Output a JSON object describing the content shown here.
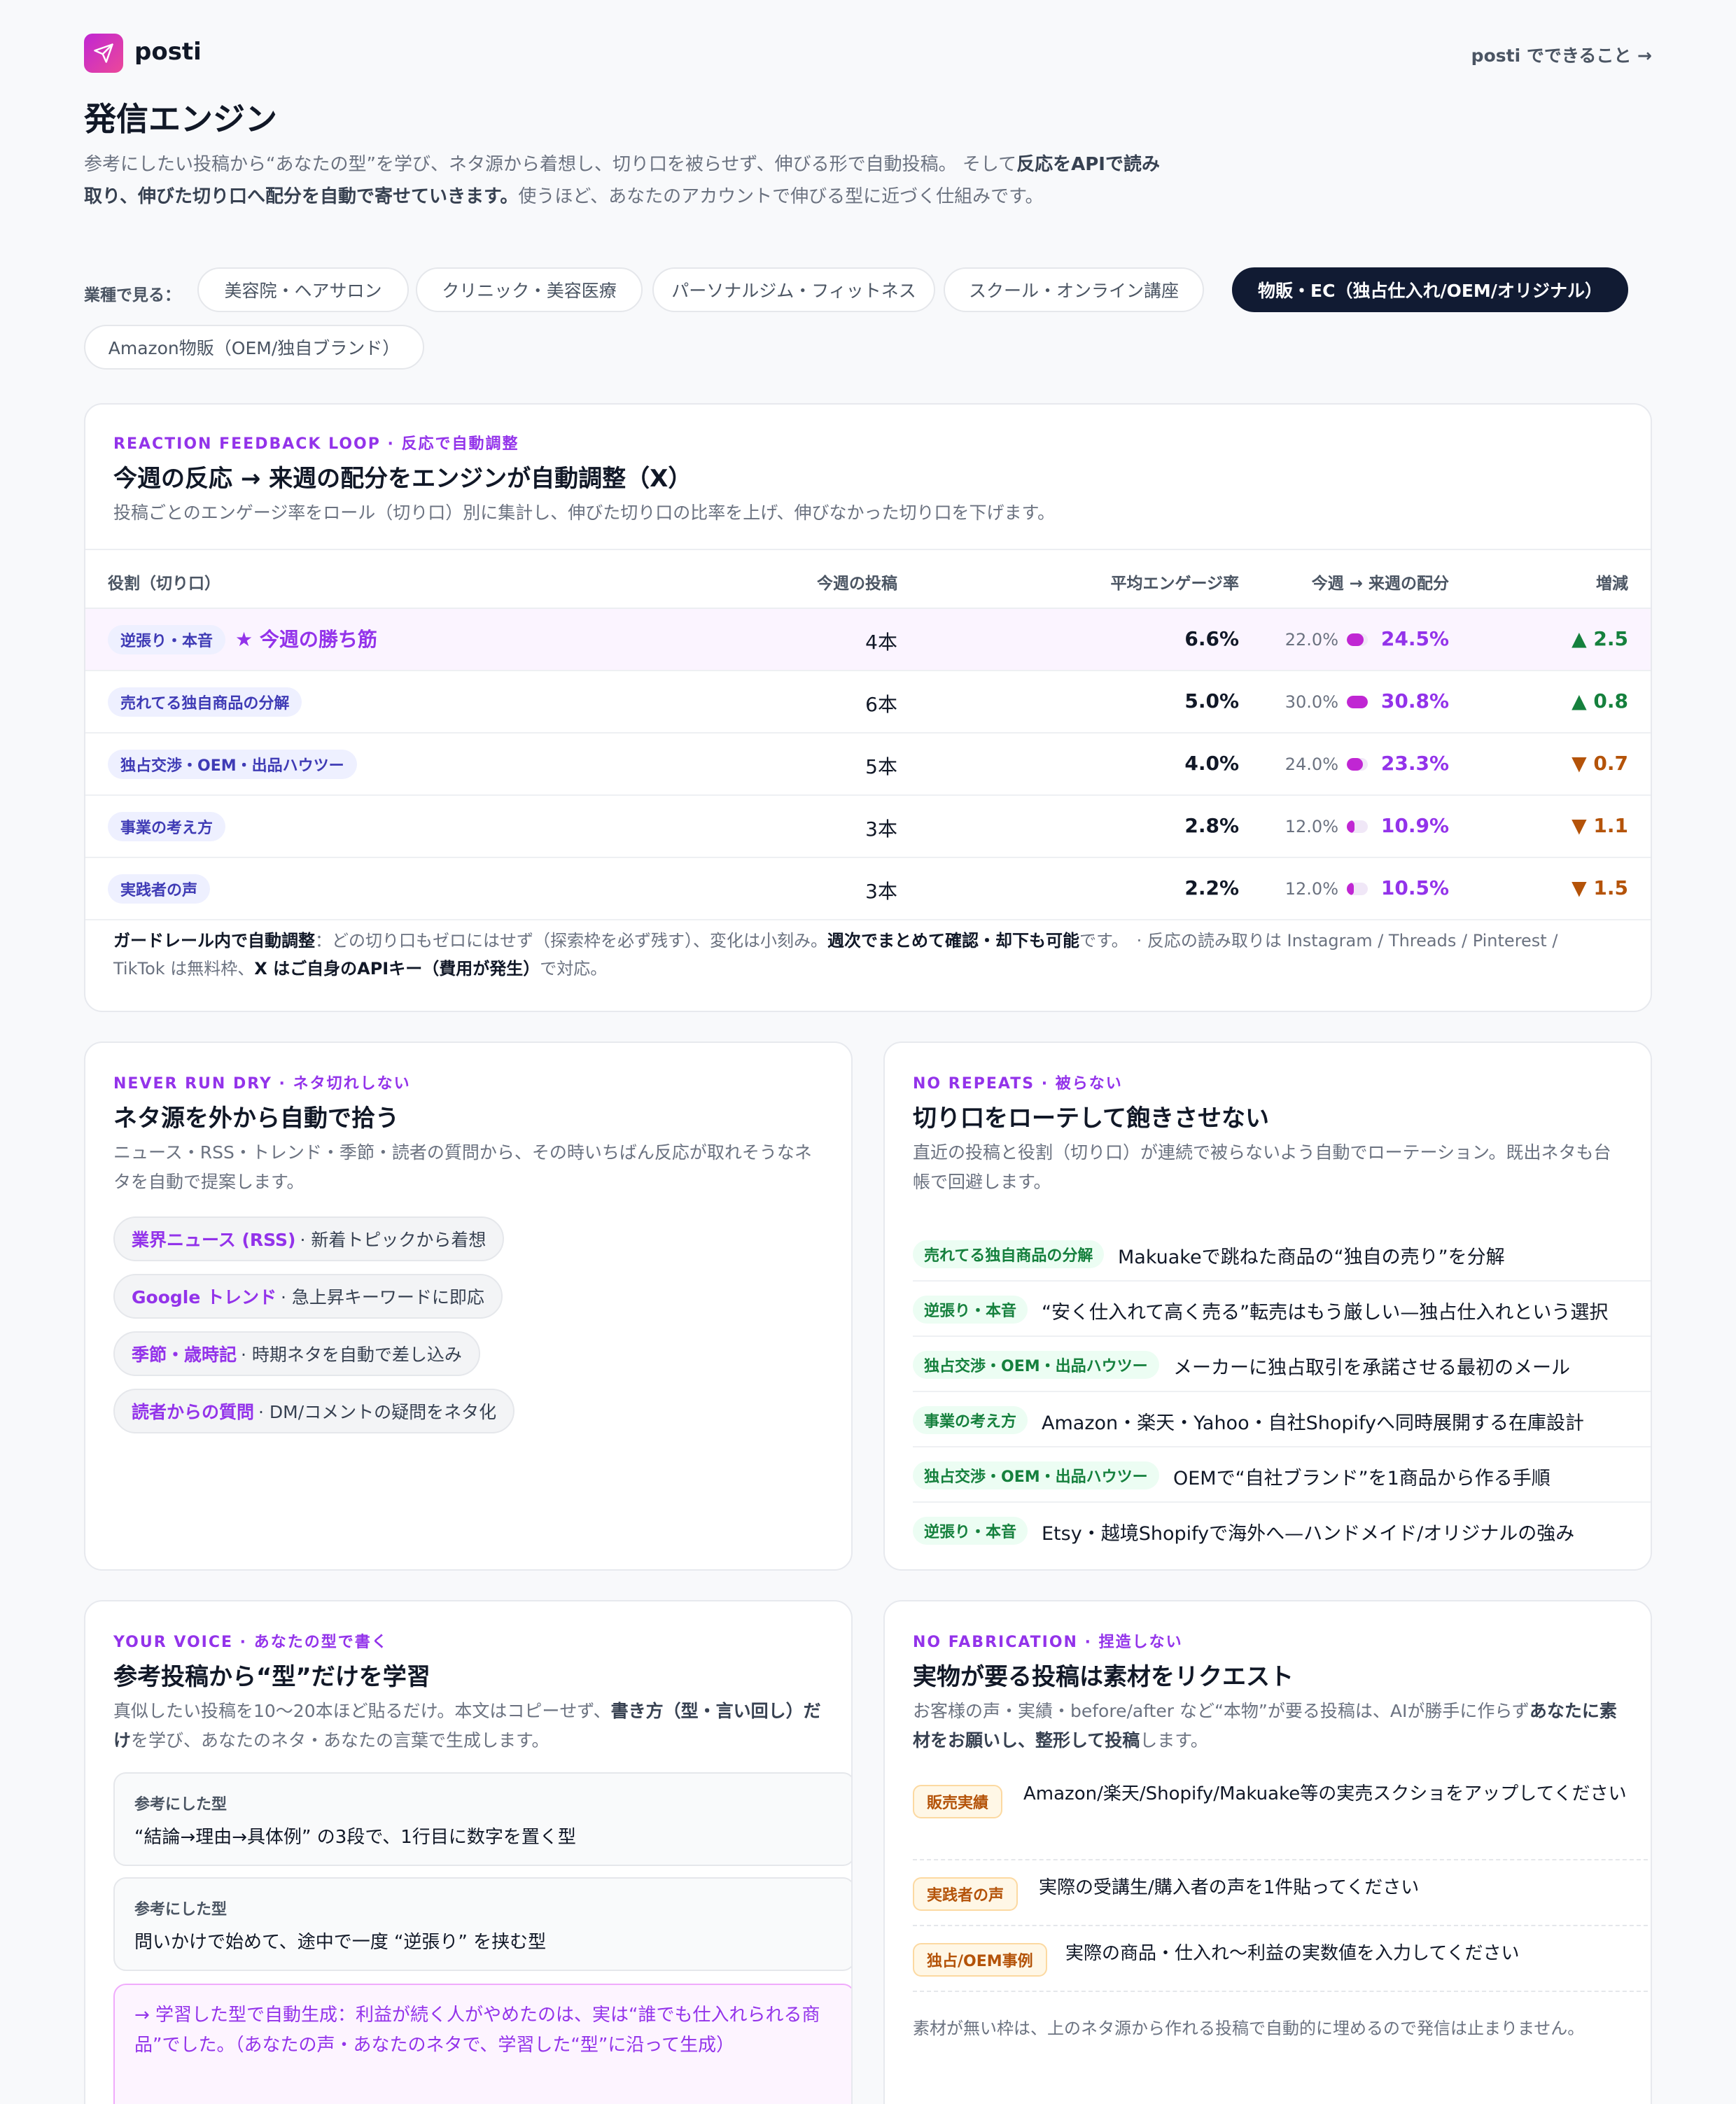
{
  "brand": {
    "name": "posti"
  },
  "header": {
    "link": "posti でできること →"
  },
  "hero": {
    "title": "発信エンジン",
    "desc_a": "参考にしたい投稿から“あなたの型”を学び、ネタ源から着想し、切り口を被らせず、伸びる形で自動投稿。 そして",
    "desc_b": "反応をAPIで読み取り、伸びた切り口へ配分を自動で寄せていきます。",
    "desc_c": "使うほど、あなたのアカウントで伸びる型に近づく仕組みです。"
  },
  "filters": {
    "label": "業種で見る：",
    "items": [
      "美容院・ヘアサロン",
      "クリニック・美容医療",
      "パーソナルジム・フィットネス",
      "スクール・オンライン講座",
      "物販・EC（独占仕入れ/OEM/オリジナル）",
      "Amazon物販（OEM/独自ブランド）"
    ],
    "active_index": 4
  },
  "loop": {
    "eyebrow": "REACTION FEEDBACK LOOP · 反応で自動調整",
    "title": "今週の反応 → 来週の配分をエンジンが自動調整（X）",
    "sub": "投稿ごとのエンゲージ率をロール（切り口）別に集計し、伸びた切り口の比率を上げ、伸びなかった切り口を下げます。",
    "columns": [
      "役割（切り口）",
      "今週の投稿",
      "平均エンゲージ率",
      "今週 → 来週の配分",
      "増減"
    ],
    "winner_label": "★ 今週の勝ち筋",
    "rows": [
      {
        "role": "逆張り・本音",
        "posts": "4本",
        "eng": "6.6%",
        "prev": "22.0%",
        "next": "24.5%",
        "next_value": 24.5,
        "delta": "▲ 2.5",
        "dir": "up",
        "winner": true
      },
      {
        "role": "売れてる独自商品の分解",
        "posts": "6本",
        "eng": "5.0%",
        "prev": "30.0%",
        "next": "30.8%",
        "next_value": 30.8,
        "delta": "▲ 0.8",
        "dir": "up",
        "winner": false
      },
      {
        "role": "独占交渉・OEM・出品ハウツー",
        "posts": "5本",
        "eng": "4.0%",
        "prev": "24.0%",
        "next": "23.3%",
        "next_value": 23.3,
        "delta": "▼ 0.7",
        "dir": "down",
        "winner": false
      },
      {
        "role": "事業の考え方",
        "posts": "3本",
        "eng": "2.8%",
        "prev": "12.0%",
        "next": "10.9%",
        "next_value": 10.9,
        "delta": "▼ 1.1",
        "dir": "down",
        "winner": false
      },
      {
        "role": "実践者の声",
        "posts": "3本",
        "eng": "2.2%",
        "prev": "12.0%",
        "next": "10.5%",
        "next_value": 10.5,
        "delta": "▼ 1.5",
        "dir": "down",
        "winner": false
      }
    ],
    "note": {
      "b1": "ガードレール内で自動調整",
      "t1": "：どの切り口もゼロにはせず（探索枠を必ず残す）、変化は小刻み。",
      "b2": "週次でまとめて確認・却下も可能",
      "t2": "です。　· 反応の読み取りは Instagram / Threads / Pinterest / TikTok は無料枠、",
      "b3": "X はご自身のAPIキー（費用が発生）",
      "t3": "で対応。"
    }
  },
  "sources": {
    "eyebrow": "NEVER RUN DRY · ネタ切れしない",
    "title": "ネタ源を外から自動で拾う",
    "sub": "ニュース・RSS・トレンド・季節・読者の質問から、その時いちばん反応が取れそうなネタを自動で提案します。",
    "items": [
      {
        "name": "業界ニュース (RSS)",
        "desc": "· 新着トピックから着想"
      },
      {
        "name": "Google トレンド",
        "desc": "· 急上昇キーワードに即応"
      },
      {
        "name": "季節・歳時記",
        "desc": "· 時期ネタを自動で差し込み"
      },
      {
        "name": "読者からの質問",
        "desc": "· DM/コメントの疑問をネタ化"
      }
    ]
  },
  "rotation": {
    "eyebrow": "NO REPEATS · 被らない",
    "title": "切り口をローテして飽きさせない",
    "sub": "直近の投稿と役割（切り口）が連続で被らないよう自動でローテーション。既出ネタも台帳で回避します。",
    "items": [
      {
        "tag": "売れてる独自商品の分解",
        "text": "Makuakeで跳ねた商品の“独自の売り”を分解"
      },
      {
        "tag": "逆張り・本音",
        "text": "“安く仕入れて高く売る”転売はもう厳しい—独占仕入れという選択"
      },
      {
        "tag": "独占交渉・OEM・出品ハウツー",
        "text": "メーカーに独占取引を承諾させる最初のメール"
      },
      {
        "tag": "事業の考え方",
        "text": "Amazon・楽天・Yahoo・自社Shopifyへ同時展開する在庫設計"
      },
      {
        "tag": "独占交渉・OEM・出品ハウツー",
        "text": "OEMで“自社ブランド”を1商品から作る手順"
      },
      {
        "tag": "逆張り・本音",
        "text": "Etsy・越境Shopifyで海外へ—ハンドメイド/オリジナルの強み"
      }
    ]
  },
  "voice": {
    "eyebrow": "YOUR VOICE · あなたの型で書く",
    "title": "参考投稿から“型”だけを学習",
    "sub_a": "真似したい投稿を10〜20本ほど貼るだけ。本文はコピーせず、",
    "sub_b": "書き方（型・言い回し）だけ",
    "sub_c": "を学び、あなたのネタ・あなたの言葉で生成します。",
    "refs": [
      {
        "label": "参考にした型",
        "text": "“結論→理由→具体例” の3段で、1行目に数字を置く型"
      },
      {
        "label": "参考にした型",
        "text": "問いかけで始めて、途中で一度 “逆張り” を挟む型"
      }
    ],
    "generated": "→ 学習した型で自動生成：利益が続く人がやめたのは、実は“誰でも仕入れられる商品”でした。（あなたの声・あなたのネタで、学習した“型”に沿って生成）"
  },
  "requests": {
    "eyebrow": "NO FABRICATION · 捏造しない",
    "title": "実物が要る投稿は素材をリクエスト",
    "sub_a": "お客様の声・実績・before/after など“本物”が要る投稿は、AIが勝手に作らず",
    "sub_b": "あなたに素材をお願いし、整形して投稿",
    "sub_c": "します。",
    "items": [
      {
        "tag": "販売実績",
        "text": "Amazon/楽天/Shopify/Makuake等の実売スクショをアップしてください"
      },
      {
        "tag": "実践者の声",
        "text": "実際の受講生/購入者の声を1件貼ってください"
      },
      {
        "tag": "独占/OEM事例",
        "text": "実際の商品・仕入れ〜利益の実数値を入力してください"
      }
    ],
    "footer": "素材が無い枠は、上のネタ源から作れる投稿で自動的に埋めるので発信は止まりません。"
  }
}
